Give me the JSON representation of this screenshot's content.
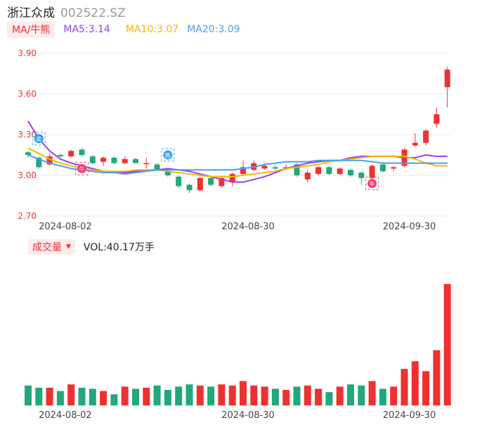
{
  "header": {
    "name": "浙江众成",
    "code": "002522.SZ"
  },
  "ma_legend": {
    "toggle_label": "MA/牛熊",
    "ma5": "MA5:3.14",
    "ma10": "MA10:3.07",
    "ma20": "MA20:3.09"
  },
  "volume_legend": {
    "toggle_label": "成交量",
    "vol": "VOL:40.17万手"
  },
  "colors": {
    "up": "#f03030",
    "down": "#22a87a",
    "ma5": "#9b3cf0",
    "ma10": "#f5b800",
    "ma20": "#4a9ff0",
    "grid": "#e8e8e8",
    "tick_red": "#e33",
    "signal_buy": "#f03c78",
    "signal_sell": "#3aa0f0"
  },
  "chart_data": {
    "type": "candlestick",
    "y_ticks": [
      "3.90",
      "3.60",
      "3.30",
      "3.00",
      "2.70"
    ],
    "y_range": [
      2.7,
      3.9
    ],
    "x_ticks": [
      {
        "label": "2024-08-02",
        "index": 3
      },
      {
        "label": "2024-08-30",
        "index": 20
      },
      {
        "label": "2024-09-30",
        "index": 35
      }
    ],
    "grid": true,
    "candles": [
      {
        "o": 3.17,
        "c": 3.15,
        "h": 3.18,
        "l": 3.13
      },
      {
        "o": 3.13,
        "c": 3.06,
        "h": 3.14,
        "l": 3.05
      },
      {
        "o": 3.08,
        "c": 3.14,
        "h": 3.16,
        "l": 3.07
      },
      {
        "o": 3.15,
        "c": 3.14,
        "h": 3.16,
        "l": 3.13
      },
      {
        "o": 3.14,
        "c": 3.18,
        "h": 3.19,
        "l": 3.13
      },
      {
        "o": 3.19,
        "c": 3.15,
        "h": 3.2,
        "l": 3.14
      },
      {
        "o": 3.14,
        "c": 3.09,
        "h": 3.15,
        "l": 3.08
      },
      {
        "o": 3.1,
        "c": 3.13,
        "h": 3.14,
        "l": 3.07
      },
      {
        "o": 3.13,
        "c": 3.09,
        "h": 3.14,
        "l": 3.08
      },
      {
        "o": 3.09,
        "c": 3.12,
        "h": 3.14,
        "l": 3.08
      },
      {
        "o": 3.12,
        "c": 3.09,
        "h": 3.13,
        "l": 3.09
      },
      {
        "o": 3.09,
        "c": 3.09,
        "h": 3.13,
        "l": 3.05
      },
      {
        "o": 3.08,
        "c": 3.04,
        "h": 3.09,
        "l": 3.03
      },
      {
        "o": 3.03,
        "c": 3.0,
        "h": 3.04,
        "l": 2.99
      },
      {
        "o": 2.99,
        "c": 2.92,
        "h": 3.0,
        "l": 2.91
      },
      {
        "o": 2.93,
        "c": 2.89,
        "h": 2.94,
        "l": 2.87
      },
      {
        "o": 2.89,
        "c": 2.98,
        "h": 2.99,
        "l": 2.88
      },
      {
        "o": 2.98,
        "c": 2.93,
        "h": 2.99,
        "l": 2.92
      },
      {
        "o": 2.92,
        "c": 2.98,
        "h": 2.99,
        "l": 2.91
      },
      {
        "o": 2.95,
        "c": 3.01,
        "h": 3.02,
        "l": 2.92
      },
      {
        "o": 3.01,
        "c": 3.06,
        "h": 3.11,
        "l": 3.0
      },
      {
        "o": 3.04,
        "c": 3.09,
        "h": 3.11,
        "l": 3.03
      },
      {
        "o": 3.05,
        "c": 3.07,
        "h": 3.09,
        "l": 3.04
      },
      {
        "o": 3.06,
        "c": 3.05,
        "h": 3.08,
        "l": 3.04
      },
      {
        "o": 3.05,
        "c": 3.06,
        "h": 3.08,
        "l": 3.04
      },
      {
        "o": 3.08,
        "c": 3.0,
        "h": 3.09,
        "l": 2.99
      },
      {
        "o": 2.97,
        "c": 3.02,
        "h": 3.04,
        "l": 2.95
      },
      {
        "o": 3.01,
        "c": 3.06,
        "h": 3.07,
        "l": 3.0
      },
      {
        "o": 3.06,
        "c": 3.01,
        "h": 3.07,
        "l": 3.0
      },
      {
        "o": 3.01,
        "c": 3.05,
        "h": 3.06,
        "l": 3.0
      },
      {
        "o": 3.04,
        "c": 3.0,
        "h": 3.05,
        "l": 2.99
      },
      {
        "o": 3.02,
        "c": 2.98,
        "h": 3.03,
        "l": 2.93
      },
      {
        "o": 2.98,
        "c": 3.07,
        "h": 3.08,
        "l": 2.97
      },
      {
        "o": 3.08,
        "c": 3.03,
        "h": 3.09,
        "l": 3.02
      },
      {
        "o": 3.05,
        "c": 3.06,
        "h": 3.07,
        "l": 3.03
      },
      {
        "o": 3.07,
        "c": 3.19,
        "h": 3.2,
        "l": 3.06
      },
      {
        "o": 3.22,
        "c": 3.24,
        "h": 3.31,
        "l": 3.21
      },
      {
        "o": 3.24,
        "c": 3.33,
        "h": 3.34,
        "l": 3.22
      },
      {
        "o": 3.38,
        "c": 3.45,
        "h": 3.5,
        "l": 3.35
      },
      {
        "o": 3.65,
        "c": 3.78,
        "h": 3.8,
        "l": 3.5
      }
    ],
    "ma5": [
      3.4,
      3.27,
      3.18,
      3.12,
      3.09,
      3.07,
      3.05,
      3.03,
      3.02,
      3.02,
      3.03,
      3.04,
      3.04,
      3.05,
      3.04,
      3.03,
      3.01,
      2.99,
      2.97,
      2.95,
      2.95,
      2.97,
      2.99,
      3.02,
      3.05,
      3.07,
      3.09,
      3.1,
      3.11,
      3.11,
      3.13,
      3.14,
      3.14,
      3.14,
      3.14,
      3.13,
      3.13,
      3.15,
      3.14,
      3.14
    ],
    "ma10": [
      3.2,
      3.16,
      3.12,
      3.09,
      3.07,
      3.05,
      3.04,
      3.03,
      3.03,
      3.03,
      3.04,
      3.04,
      3.04,
      3.03,
      3.02,
      3.01,
      3.0,
      2.99,
      2.99,
      2.99,
      3.0,
      3.01,
      3.02,
      3.03,
      3.05,
      3.06,
      3.07,
      3.08,
      3.1,
      3.11,
      3.12,
      3.13,
      3.14,
      3.14,
      3.14,
      3.14,
      3.12,
      3.09,
      3.07,
      3.07
    ],
    "ma20": [
      3.15,
      3.12,
      3.09,
      3.07,
      3.05,
      3.04,
      3.03,
      3.02,
      3.02,
      3.01,
      3.02,
      3.03,
      3.04,
      3.04,
      3.04,
      3.04,
      3.04,
      3.04,
      3.04,
      3.04,
      3.05,
      3.06,
      3.08,
      3.09,
      3.1,
      3.1,
      3.1,
      3.11,
      3.11,
      3.11,
      3.11,
      3.11,
      3.1,
      3.09,
      3.09,
      3.09,
      3.09,
      3.09,
      3.09,
      3.09
    ],
    "signals": [
      {
        "index": 1,
        "price": 3.26,
        "label": "卖",
        "kind": "sell",
        "pos": "above"
      },
      {
        "index": 5,
        "price": 3.06,
        "label": "牛",
        "kind": "buy",
        "pos": "below"
      },
      {
        "index": 13,
        "price": 3.14,
        "label": "熊",
        "kind": "sell",
        "pos": "above"
      },
      {
        "index": 32,
        "price": 2.95,
        "label": "牛",
        "kind": "buy",
        "pos": "below"
      }
    ],
    "volume": [
      18,
      16,
      16,
      13,
      19,
      16,
      15,
      13,
      10,
      17,
      15,
      16,
      18,
      14,
      17,
      19,
      18,
      17,
      19,
      18,
      22,
      18,
      17,
      15,
      14,
      17,
      18,
      15,
      12,
      17,
      19,
      18,
      22,
      15,
      17,
      33,
      40,
      31,
      50,
      110
    ]
  }
}
